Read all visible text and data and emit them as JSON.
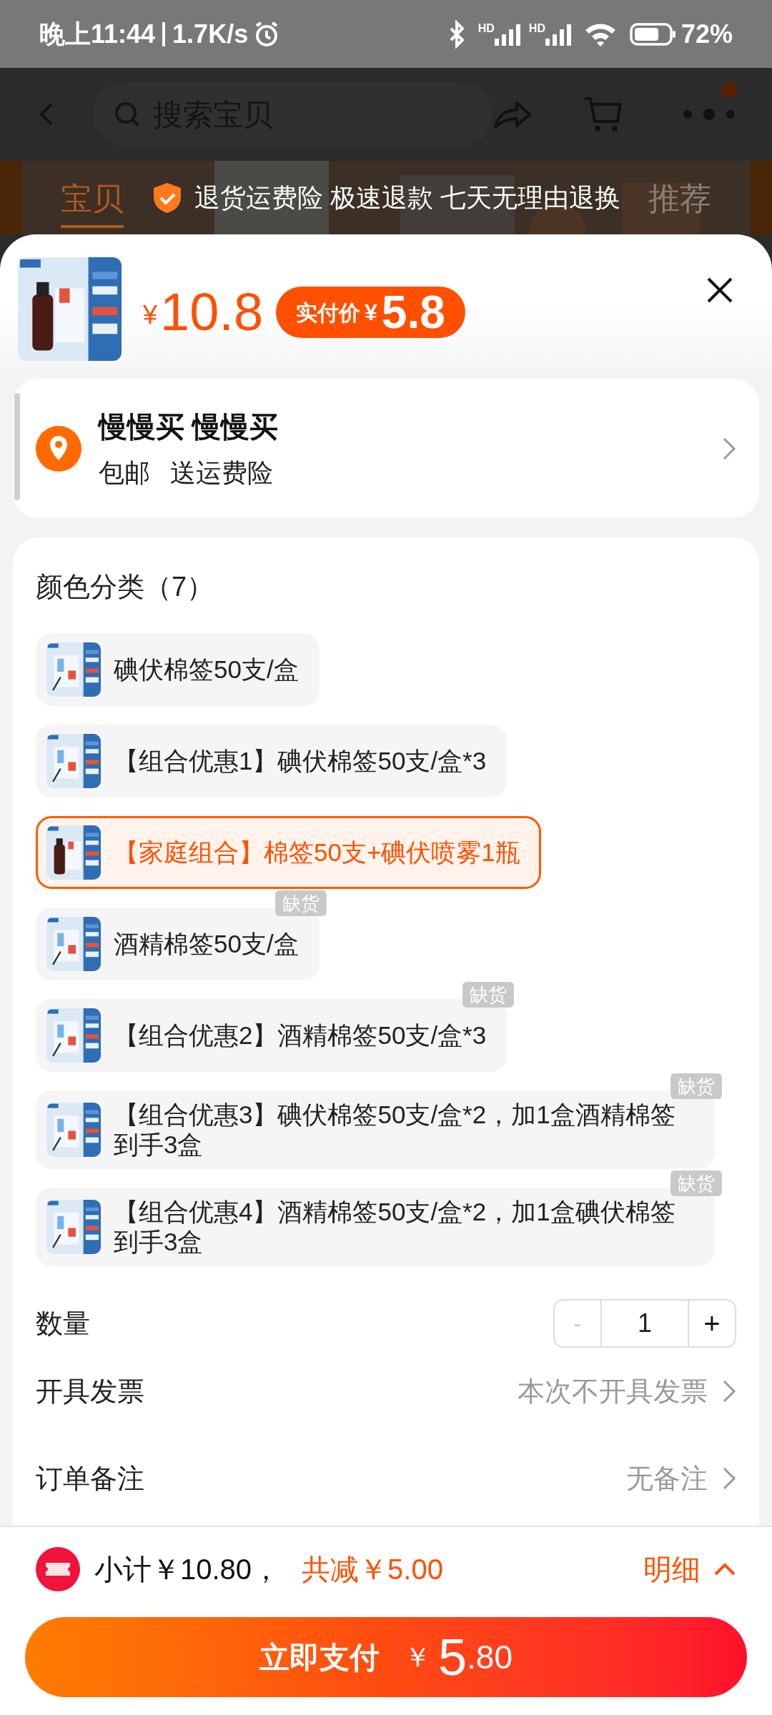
{
  "status_bar": {
    "time": "晚上11:44",
    "speed": "1.7K/s",
    "signal_labels": [
      "HD",
      "HD"
    ],
    "battery": "72%"
  },
  "nav": {
    "search_placeholder": "搜索宝贝"
  },
  "background_tabs": [
    {
      "label": "宝贝",
      "selected": true
    },
    {
      "label": "推荐",
      "selected": false
    }
  ],
  "banner": {
    "text": "退货运费险 极速退款 七天无理由退换"
  },
  "header": {
    "price_symbol": "¥",
    "price": "10.8",
    "final_label": "实付价",
    "final_symbol": "¥",
    "final_price": "5.8"
  },
  "address": {
    "name": "慢慢买 慢慢买",
    "tags": [
      "包邮",
      "送运费险"
    ]
  },
  "sku": {
    "title": "颜色分类（7）",
    "options": [
      {
        "label": "碘伏棉签50支/盒",
        "selected": false
      },
      {
        "label": "【组合优惠1】碘伏棉签50支/盒*3",
        "selected": false
      },
      {
        "label": "【家庭组合】棉签50支+碘伏喷雾1瓶",
        "selected": true
      },
      {
        "label": "酒精棉签50支/盒",
        "selected": false,
        "badge": "缺货"
      },
      {
        "label": "【组合优惠2】酒精棉签50支/盒*3",
        "selected": false,
        "badge": "缺货"
      },
      {
        "label": "【组合优惠3】碘伏棉签50支/盒*2，加1盒酒精棉签到手3盒",
        "selected": false,
        "badge": "缺货"
      },
      {
        "label": "【组合优惠4】酒精棉签50支/盒*2，加1盒碘伏棉签到手3盒",
        "selected": false,
        "badge": "缺货"
      }
    ]
  },
  "quantity": {
    "label": "数量",
    "minus": "-",
    "value": "1",
    "plus": "+",
    "minus_disabled": true
  },
  "rows": [
    {
      "label": "开具发票",
      "value": "本次不开具发票"
    },
    {
      "label": "订单备注",
      "value": "无备注"
    }
  ],
  "footer": {
    "subtotal": "小计￥10.80，",
    "discount": "共减￥5.00",
    "detail": "明细",
    "pay_label": "立即支付",
    "pay_symbol": "￥",
    "pay_int": "5",
    "pay_dec": ".80"
  }
}
